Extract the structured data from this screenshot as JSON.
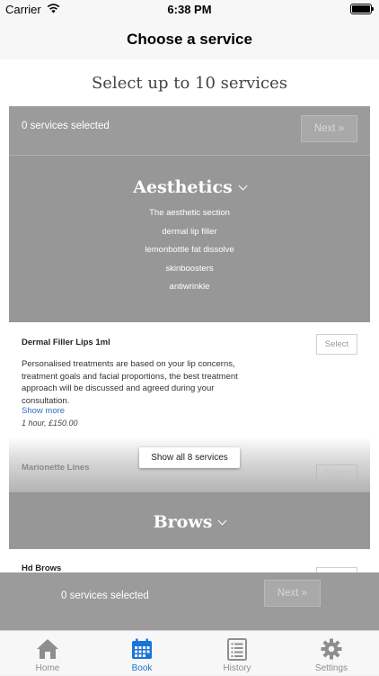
{
  "status_bar": {
    "carrier": "Carrier",
    "time": "6:38 PM"
  },
  "navbar": {
    "title": "Choose a service"
  },
  "main": {
    "subtitle": "Select up to 10 services",
    "selected_count": "0 services selected",
    "next_label": "Next",
    "categories": [
      {
        "title": "Aesthetics",
        "items": [
          "The aesthetic section",
          "dermal lip filler",
          "lemonbottle fat dissolve",
          "skinboosters",
          "antiwrinkle"
        ]
      },
      {
        "title": "Brows"
      }
    ],
    "services": [
      {
        "name": "Dermal Filler Lips 1ml",
        "description": "Personalised treatments are based on your lip concerns, treatment goals and facial proportions, the best treatment approach will be discussed and agreed during your consultation.",
        "show_more": "Show more",
        "meta": "1 hour, £150.00",
        "select_label": "Select"
      },
      {
        "name": "Marionette Lines",
        "select_label": "Select"
      },
      {
        "name": "Hd Brows"
      }
    ],
    "show_all_label": "Show all 8 services"
  },
  "bottom_bar": {
    "selected_count": "0 services selected",
    "next_label": "Next"
  },
  "tabs": [
    {
      "label": "Home",
      "icon": "home-icon",
      "active": false
    },
    {
      "label": "Book",
      "icon": "calendar-icon",
      "active": true
    },
    {
      "label": "History",
      "icon": "list-icon",
      "active": false
    },
    {
      "label": "Settings",
      "icon": "gear-icon",
      "active": false
    }
  ],
  "colors": {
    "accent": "#1b74d9",
    "overlay_gray": "#9b9b9b",
    "link": "#2f6fc4"
  }
}
